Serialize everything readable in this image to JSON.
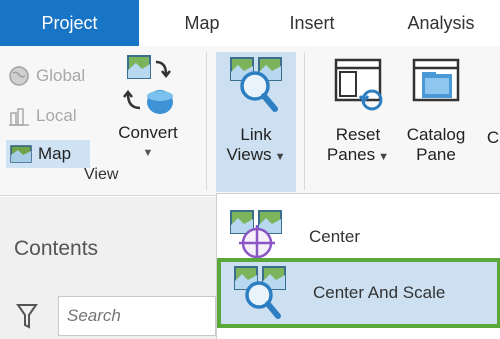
{
  "tabs": [
    "Project",
    "Map",
    "Insert",
    "Analysis"
  ],
  "view_group": {
    "global": "Global",
    "local": "Local",
    "map": "Map",
    "convert": "Convert",
    "label": "View"
  },
  "link_views": {
    "line1": "Link",
    "line2": "Views"
  },
  "reset_panes": {
    "line1": "Reset",
    "line2": "Panes"
  },
  "catalog_pane": {
    "line1": "Catalog",
    "line2": "Pane"
  },
  "cut_off_letter": "C",
  "contents": {
    "title": "Contents",
    "search_placeholder": "Search"
  },
  "dropdown": {
    "items": [
      "Center",
      "Center And Scale"
    ],
    "highlighted_index": 1
  },
  "colors": {
    "active_tab": "#1874c4",
    "highlight_fill": "#cde0f1",
    "highlight_border": "#5aa83a"
  }
}
